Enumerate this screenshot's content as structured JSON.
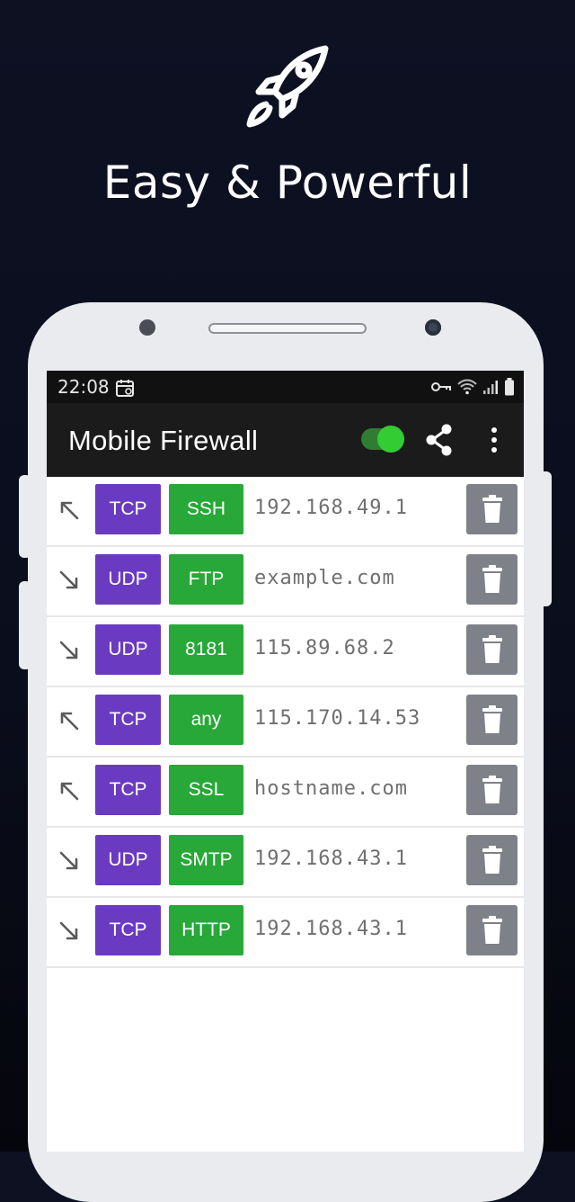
{
  "hero": {
    "title": "Easy & Powerful",
    "icon": "rocket-icon"
  },
  "status_bar": {
    "time": "22:08",
    "icons": [
      "calendar-icon",
      "vpn-key-icon",
      "wifi-icon",
      "signal-icon",
      "battery-icon"
    ]
  },
  "app_bar": {
    "title": "Mobile Firewall",
    "toggle_on": true,
    "actions": [
      "share-icon",
      "more-vert-icon"
    ]
  },
  "colors": {
    "tcp": "#6a3bc1",
    "udp": "#6a3bc1",
    "port": "#27a838",
    "delete": "#7e8288",
    "toggle": "#33cc33"
  },
  "rules": [
    {
      "direction": "outbound",
      "protocol": "TCP",
      "port": "SSH",
      "host": "192.168.49.1"
    },
    {
      "direction": "inbound",
      "protocol": "UDP",
      "port": "FTP",
      "host": "example.com"
    },
    {
      "direction": "inbound",
      "protocol": "UDP",
      "port": "8181",
      "host": "115.89.68.2"
    },
    {
      "direction": "outbound",
      "protocol": "TCP",
      "port": "any",
      "host": "115.170.14.53"
    },
    {
      "direction": "outbound",
      "protocol": "TCP",
      "port": "SSL",
      "host": "hostname.com"
    },
    {
      "direction": "inbound",
      "protocol": "UDP",
      "port": "SMTP",
      "host": "192.168.43.1"
    },
    {
      "direction": "inbound",
      "protocol": "TCP",
      "port": "HTTP",
      "host": "192.168.43.1"
    }
  ]
}
